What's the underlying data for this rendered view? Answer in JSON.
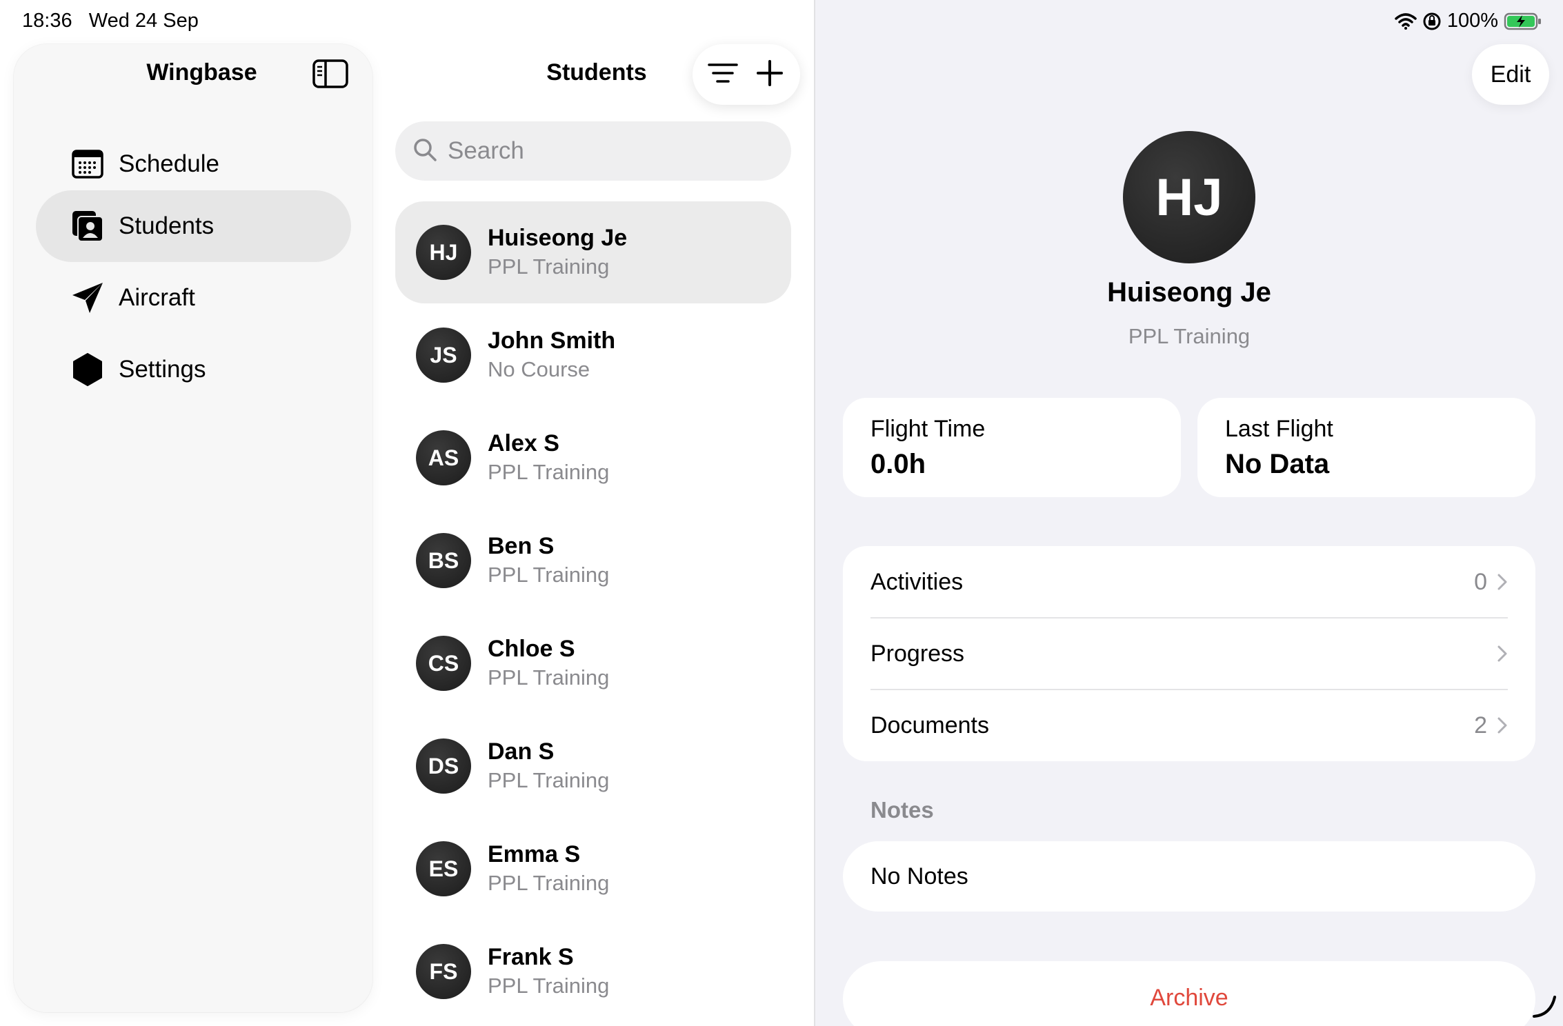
{
  "status_bar": {
    "time": "18:36",
    "date": "Wed 24 Sep",
    "battery": "100%",
    "battery_color": "#34c759"
  },
  "sidebar": {
    "title": "Wingbase",
    "toggle_icon": "sidebar-toggle-icon",
    "items": [
      {
        "label": "Schedule",
        "icon": "calendar-icon",
        "selected": false
      },
      {
        "label": "Students",
        "icon": "student-id-icon",
        "selected": true
      },
      {
        "label": "Aircraft",
        "icon": "paper-plane-icon",
        "selected": false
      },
      {
        "label": "Settings",
        "icon": "hexagon-icon",
        "selected": false
      }
    ]
  },
  "list": {
    "title": "Students",
    "search_placeholder": "Search",
    "students": [
      {
        "initials": "HJ",
        "name": "Huiseong Je",
        "course": "PPL Training",
        "selected": true
      },
      {
        "initials": "JS",
        "name": "John Smith",
        "course": "No Course",
        "selected": false
      },
      {
        "initials": "AS",
        "name": "Alex S",
        "course": "PPL Training",
        "selected": false
      },
      {
        "initials": "BS",
        "name": "Ben S",
        "course": "PPL Training",
        "selected": false
      },
      {
        "initials": "CS",
        "name": "Chloe S",
        "course": "PPL Training",
        "selected": false
      },
      {
        "initials": "DS",
        "name": "Dan S",
        "course": "PPL Training",
        "selected": false
      },
      {
        "initials": "ES",
        "name": "Emma S",
        "course": "PPL Training",
        "selected": false
      },
      {
        "initials": "FS",
        "name": "Frank S",
        "course": "PPL Training",
        "selected": false
      }
    ]
  },
  "detail": {
    "edit_label": "Edit",
    "initials": "HJ",
    "name": "Huiseong Je",
    "course": "PPL Training",
    "stats": [
      {
        "label": "Flight Time",
        "value": "0.0h"
      },
      {
        "label": "Last Flight",
        "value": "No Data"
      }
    ],
    "rows": [
      {
        "label": "Activities",
        "count": "0"
      },
      {
        "label": "Progress",
        "count": ""
      },
      {
        "label": "Documents",
        "count": "2"
      }
    ],
    "notes_header": "Notes",
    "notes_text": "No Notes",
    "archive_label": "Archive",
    "archive_color": "#e0483c"
  }
}
